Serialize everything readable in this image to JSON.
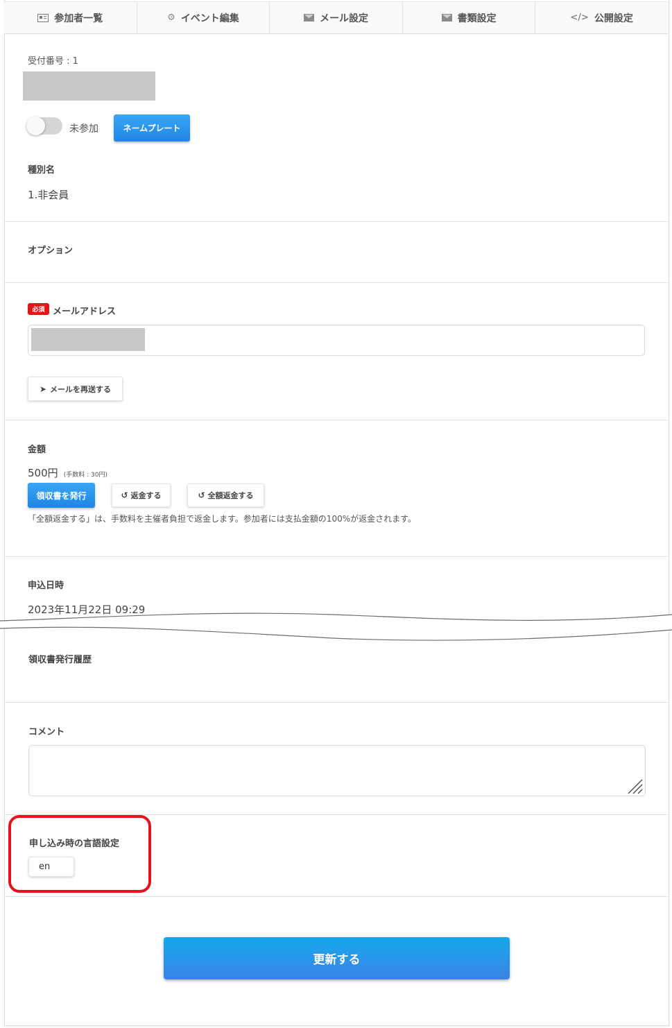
{
  "tabs": [
    {
      "label": "参加者一覧",
      "icon": "id-card-icon"
    },
    {
      "label": "イベント編集",
      "icon": "gear-icon"
    },
    {
      "label": "メール設定",
      "icon": "envelope-icon"
    },
    {
      "label": "書類設定",
      "icon": "envelope-icon"
    },
    {
      "label": "公開設定",
      "icon": "code-icon"
    }
  ],
  "receipt": {
    "label": "受付番号 : 1"
  },
  "attendance": {
    "status": "未参加",
    "nameplate_button": "ネームプレート"
  },
  "category": {
    "label": "種別名",
    "value": "1.非会員"
  },
  "option": {
    "label": "オプション"
  },
  "email": {
    "required_badge": "必須",
    "label": "メールアドレス",
    "resend_button": "メールを再送する"
  },
  "amount": {
    "label": "金額",
    "value": "500円",
    "fee": "(手数料 : 30円)",
    "issue_receipt_button": "領収書を発行",
    "refund_button": "返金する",
    "full_refund_button": "全額返金する",
    "note": "「全額返金する」は、手数料を主催者負担で返金します。参加者には支払金額の100%が返金されます。"
  },
  "applied": {
    "label": "申込日時",
    "value": "2023年11月22日 09:29"
  },
  "receipt_history": {
    "label": "領収書発行履歴"
  },
  "comment": {
    "label": "コメント",
    "value": ""
  },
  "language": {
    "label": "申し込み時の言語設定",
    "value": "en"
  },
  "update_button": "更新する",
  "colors": {
    "accent": "#1f86e4",
    "required": "#e31515",
    "highlight": "#e8121e"
  }
}
